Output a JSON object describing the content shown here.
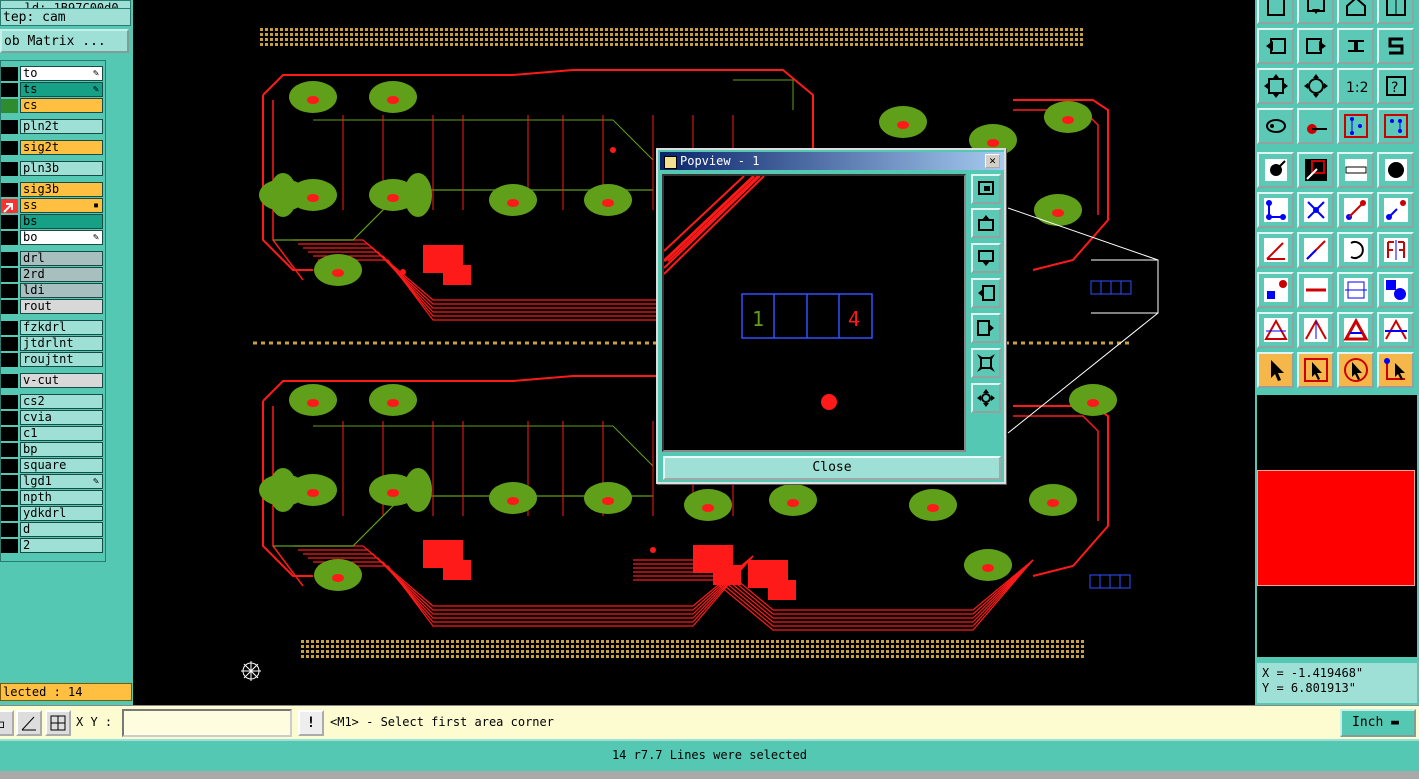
{
  "left_panel": {
    "job_id": "...ld: 1B97C00d0",
    "step": "tep: cam",
    "job_matrix_label": "ob Matrix ...",
    "layers": [
      {
        "name": "to",
        "color": "#ffffff",
        "mark": "#000000",
        "flag": "edit-icon"
      },
      {
        "name": "ts",
        "color": "#16a085",
        "mark": "#000000",
        "flag": "edit-icon"
      },
      {
        "name": "cs",
        "color": "#ffbf40",
        "mark": "#2e8b2e",
        "flag": ""
      },
      {
        "name": "pln2t",
        "color": "#9fe0d6",
        "mark": "#000000",
        "flag": ""
      },
      {
        "name": "sig2t",
        "color": "#ffbf40",
        "mark": "#000000",
        "flag": ""
      },
      {
        "name": "pln3b",
        "color": "#9fe0d6",
        "mark": "#000000",
        "flag": ""
      },
      {
        "name": "sig3b",
        "color": "#ffbf40",
        "mark": "#000000",
        "flag": ""
      },
      {
        "name": "ss",
        "color": "#ffbf40",
        "mark": "#ff3030",
        "flag": "dot-icon"
      },
      {
        "name": "bs",
        "color": "#16a085",
        "mark": "#000000",
        "flag": ""
      },
      {
        "name": "bo",
        "color": "#ffffff",
        "mark": "#000000",
        "flag": "edit-icon"
      },
      {
        "name": "drl",
        "color": "#a8bfc0",
        "mark": "#000000",
        "flag": ""
      },
      {
        "name": "2rd",
        "color": "#a8bfc0",
        "mark": "#000000",
        "flag": ""
      },
      {
        "name": "ldi",
        "color": "#a8bfc0",
        "mark": "#000000",
        "flag": ""
      },
      {
        "name": "rout",
        "color": "#d8d8d8",
        "mark": "#000000",
        "flag": ""
      },
      {
        "name": "fzkdrl",
        "color": "#9fe0d6",
        "mark": "#000000",
        "flag": ""
      },
      {
        "name": "jtdrlnt",
        "color": "#9fe0d6",
        "mark": "#000000",
        "flag": ""
      },
      {
        "name": "roujtnt",
        "color": "#9fe0d6",
        "mark": "#000000",
        "flag": ""
      },
      {
        "name": "v-cut",
        "color": "#d8d8d8",
        "mark": "#000000",
        "flag": ""
      },
      {
        "name": "cs2",
        "color": "#9fe0d6",
        "mark": "#000000",
        "flag": ""
      },
      {
        "name": "cvia",
        "color": "#9fe0d6",
        "mark": "#000000",
        "flag": ""
      },
      {
        "name": "c1",
        "color": "#9fe0d6",
        "mark": "#000000",
        "flag": ""
      },
      {
        "name": "bp",
        "color": "#9fe0d6",
        "mark": "#000000",
        "flag": ""
      },
      {
        "name": "square",
        "color": "#9fe0d6",
        "mark": "#000000",
        "flag": ""
      },
      {
        "name": "lgd1",
        "color": "#9fe0d6",
        "mark": "#000000",
        "flag": "edit-icon"
      },
      {
        "name": "npth",
        "color": "#9fe0d6",
        "mark": "#000000",
        "flag": ""
      },
      {
        "name": "ydkdrl",
        "color": "#9fe0d6",
        "mark": "#000000",
        "flag": ""
      },
      {
        "name": "d",
        "color": "#9fe0d6",
        "mark": "#000000",
        "flag": ""
      },
      {
        "name": "2",
        "color": "#9fe0d6",
        "mark": "#000000",
        "flag": ""
      }
    ],
    "selected_count": "lected : 14"
  },
  "popview": {
    "title": "Popview - 1",
    "close_label": "Close",
    "pad_labels": [
      "1",
      "4"
    ],
    "buttons": [
      "zoom-window-icon",
      "zoom-in-icon",
      "zoom-out-icon",
      "pan-left-icon",
      "pan-right-icon",
      "zoom-fit-icon",
      "zoom-home-icon"
    ]
  },
  "right_panel": {
    "toolbar_icons": [
      "window-icon",
      "window-down-icon",
      "home-icon",
      "grid-icon",
      "pan-left-icon",
      "pan-right-icon",
      "sync-icon",
      "snap-s-icon",
      "fit-icon",
      "center-icon",
      "scale-1-2-icon",
      "help-icon",
      "measure-icon",
      "probe-icon",
      "layers-compare-icon",
      "layers-compare-alt-icon",
      "select-net-icon",
      "select-feature-icon",
      "ruler-icon",
      "pad-icon",
      "connect-icon",
      "delete-point-icon",
      "extend-icon",
      "move-icon",
      "line-angle-icon",
      "line-icon",
      "arc-icon",
      "mirror-icon",
      "pad-add-icon",
      "line-red-icon",
      "dimension-icon",
      "shape-icon",
      "triangle-icon",
      "triangle-up-icon",
      "triangle-bold-icon",
      "triangle-split-icon",
      "pointer-icon",
      "pointer-box-icon",
      "pointer-circle-icon",
      "pointer-net-icon"
    ],
    "coord_x": "X = -1.419468\"",
    "coord_y": "Y = 6.801913\""
  },
  "command_bar": {
    "xy_label": "X Y :",
    "xy_value": "",
    "prompt": "<M1> - Select first area corner",
    "unit": "Inch"
  },
  "status": {
    "message": "14 r7.7 Lines were selected"
  },
  "colors": {
    "panel": "#55c8b4",
    "copper": "#ff1a1a",
    "pad_green": "#5f9f1a",
    "silkscreen": "#c8a040"
  }
}
